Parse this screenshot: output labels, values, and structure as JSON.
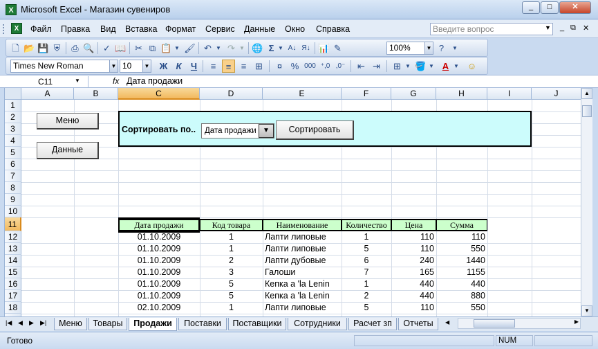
{
  "window": {
    "title": "Microsoft Excel - Магазин сувениров",
    "app_icon_letter": "X",
    "min": "_",
    "restore": "□",
    "close": "✕"
  },
  "menu": [
    "Файл",
    "Правка",
    "Вид",
    "Вставка",
    "Формат",
    "Сервис",
    "Данные",
    "Окно",
    "Справка"
  ],
  "help": {
    "placeholder": "Введите вопрос"
  },
  "toolbar1": {
    "zoom": "100%"
  },
  "toolbar2": {
    "font": "Times New Roman",
    "size": "10",
    "bold": "Ж",
    "italic": "К",
    "underline": "Ч",
    "percent": "%",
    "thousands": "000"
  },
  "formula_bar": {
    "cell_ref": "C11",
    "fx": "fx",
    "value": "Дата продажи"
  },
  "columns": [
    "A",
    "B",
    "C",
    "D",
    "E",
    "F",
    "G",
    "H",
    "I",
    "J"
  ],
  "selected_column": "C",
  "rows": [
    "1",
    "2",
    "3",
    "4",
    "5",
    "6",
    "7",
    "8",
    "9",
    "10",
    "11",
    "12",
    "13",
    "14",
    "15",
    "16",
    "17",
    "18"
  ],
  "selected_row": "11",
  "buttons": {
    "menu": "Меню",
    "data": "Данные",
    "sort": "Сортировать"
  },
  "sort_panel": {
    "label": "Сортировать по..",
    "selected": "Дата продажи",
    "dropdown_arrow": "▼"
  },
  "table": {
    "headers": [
      "Дата продажи",
      "Код товара",
      "Наименование",
      "Количество",
      "Цена",
      "Сумма"
    ],
    "rows": [
      [
        "01.10.2009",
        "1",
        "Лапти липовые",
        "1",
        "110",
        "110"
      ],
      [
        "01.10.2009",
        "1",
        "Лапти липовые",
        "5",
        "110",
        "550"
      ],
      [
        "01.10.2009",
        "2",
        "Лапти дубовые",
        "6",
        "240",
        "1440"
      ],
      [
        "01.10.2009",
        "3",
        "Галоши",
        "7",
        "165",
        "1155"
      ],
      [
        "01.10.2009",
        "5",
        "Кепка а 'la Lenin",
        "1",
        "440",
        "440"
      ],
      [
        "01.10.2009",
        "5",
        "Кепка а 'la Lenin",
        "2",
        "440",
        "880"
      ],
      [
        "02.10.2009",
        "1",
        "Лапти липовые",
        "5",
        "110",
        "550"
      ]
    ]
  },
  "sheet_tabs": [
    "Меню",
    "Товары",
    "Продажи",
    "Поставки",
    "Поставщики",
    "Сотрудники",
    "Расчет зп",
    "Отчеты"
  ],
  "active_tab": "Продажи",
  "status": {
    "ready": "Готово",
    "num": "NUM"
  }
}
